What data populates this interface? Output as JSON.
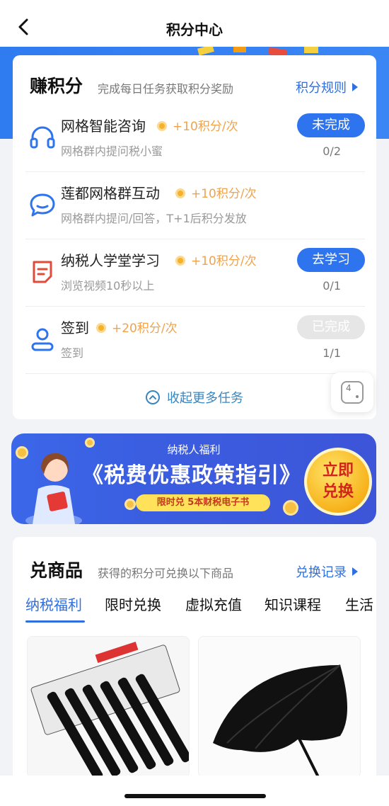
{
  "header": {
    "title": "积分中心"
  },
  "earn": {
    "title": "赚积分",
    "subtitle": "完成每日任务获取积分奖励",
    "rules_link": "积分规则",
    "tasks": [
      {
        "name": "网格智能咨询",
        "points": "+10积分/次",
        "desc": "网格群内提问税小蜜",
        "status": "未完成",
        "progress": "0/2",
        "icon": "headphones-icon"
      },
      {
        "name": "莲都网格群互动",
        "points": "+10积分/次",
        "desc": "网格群内提问/回答，T+1后积分发放",
        "status": "",
        "progress": "",
        "icon": "chat-bubble-icon"
      },
      {
        "name": "纳税人学堂学习",
        "points": "+10积分/次",
        "desc": "浏览视频10秒以上",
        "status": "去学习",
        "progress": "0/1",
        "icon": "document-icon"
      },
      {
        "name": "签到",
        "points": "+20积分/次",
        "desc": "签到",
        "status": "已完成",
        "progress": "1/1",
        "icon": "user-icon"
      }
    ],
    "collapse_label": "收起更多任务"
  },
  "float_button": {
    "label": "4"
  },
  "banner": {
    "top_text": "纳税人福利",
    "main_text": "《税费优惠政策指引》",
    "tag_text": "限时兑   5本财税电子书",
    "button_line1": "立即",
    "button_line2": "兑换"
  },
  "shop": {
    "title": "兑商品",
    "subtitle": "获得的积分可兑换以下商品",
    "records_link": "兑换记录",
    "tabs": [
      "纳税福利",
      "限时兑换",
      "虚拟充值",
      "知识课程",
      "生活"
    ],
    "products": [
      {
        "icon": "pen-set-image"
      },
      {
        "icon": "umbrella-image"
      }
    ]
  },
  "colors": {
    "primary": "#2e74ee",
    "points": "#f0a34b"
  }
}
